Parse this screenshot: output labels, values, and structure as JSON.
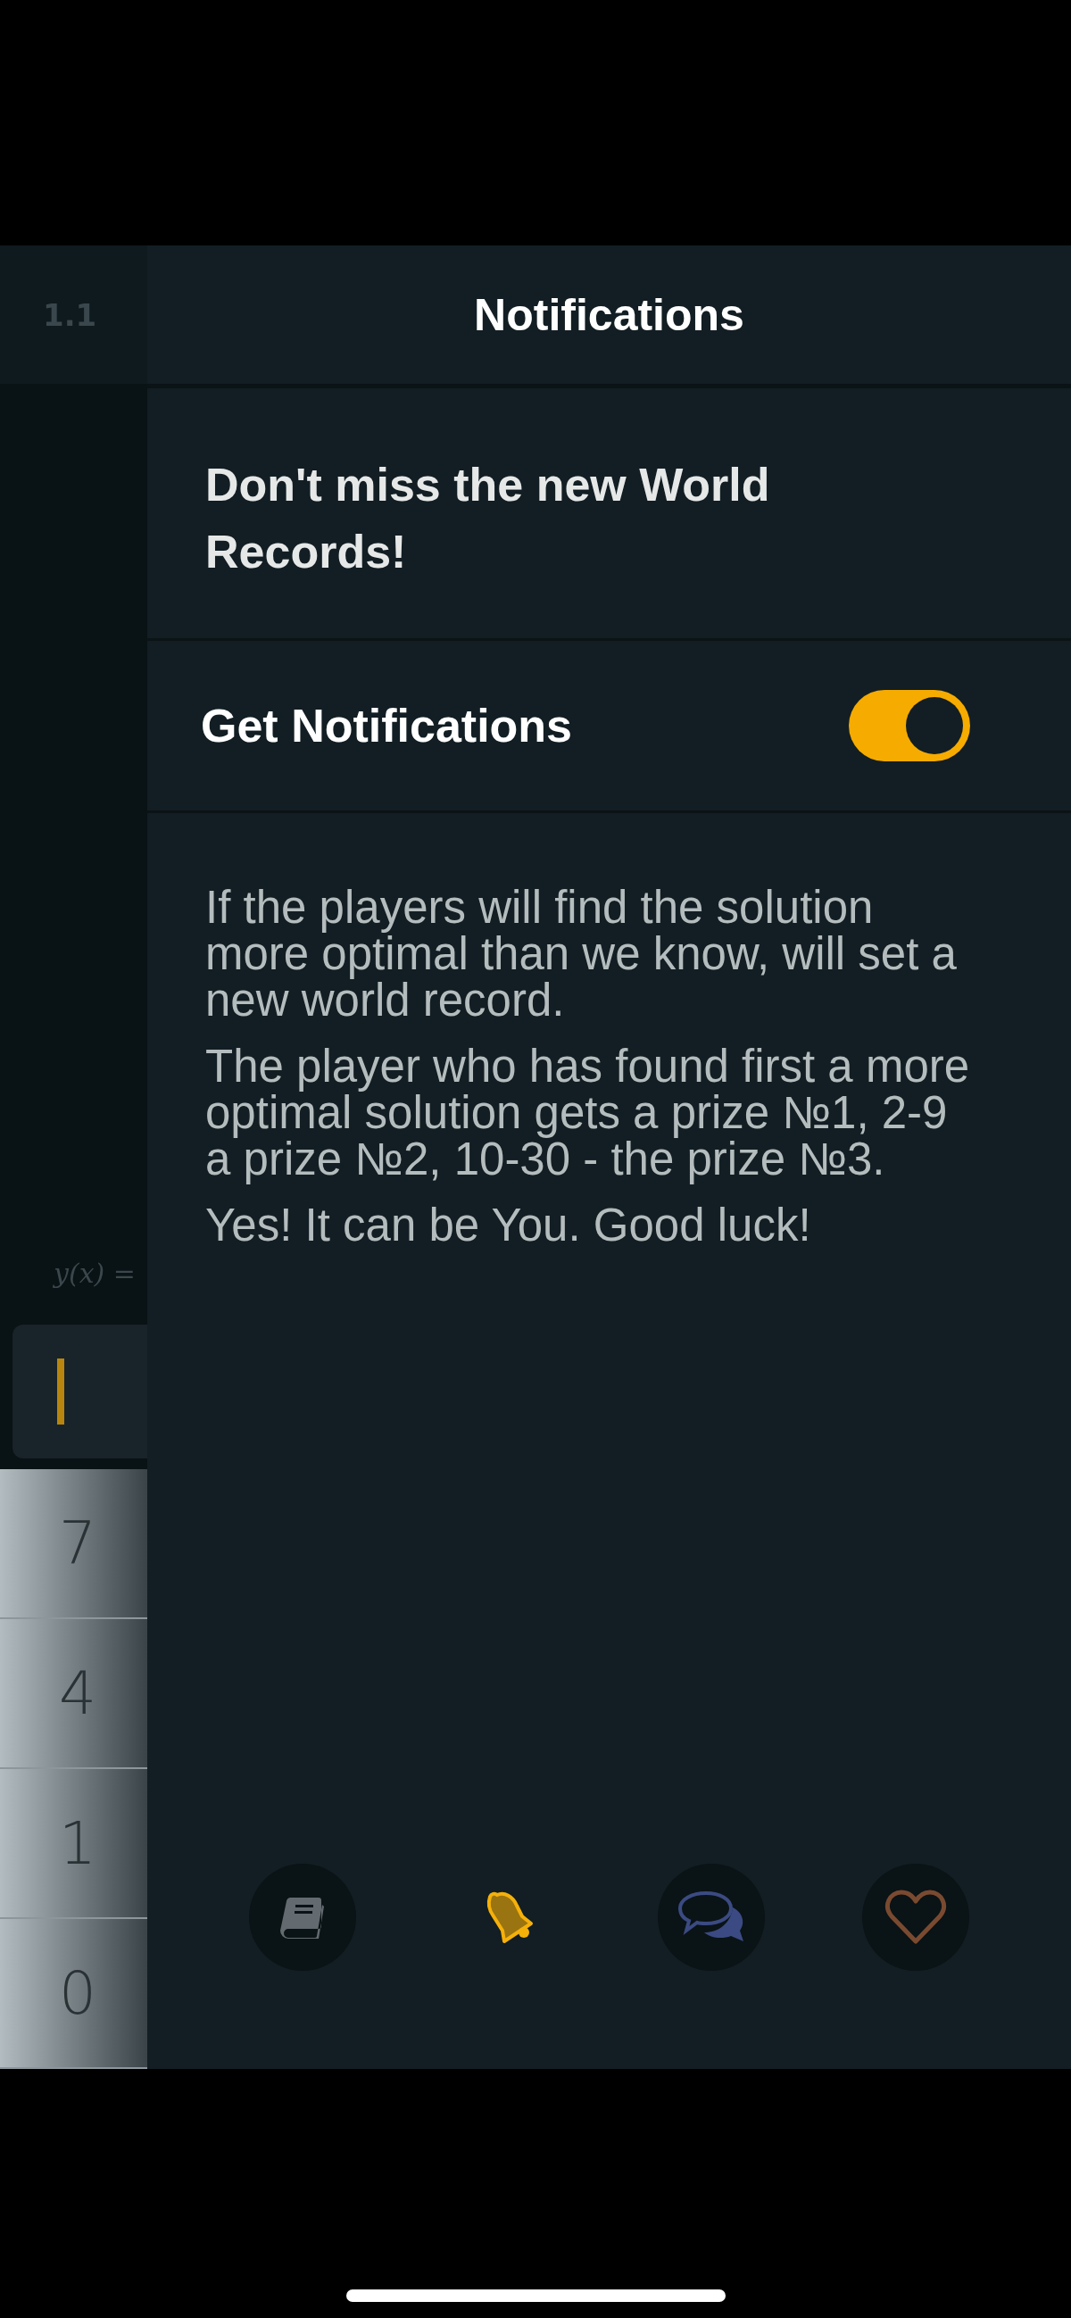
{
  "background_app": {
    "tab_label": "1.1",
    "formula_label": "y(x) =",
    "keypad_keys": [
      "7",
      "4",
      "1",
      "0"
    ]
  },
  "header": {
    "title": "Notifications"
  },
  "promo": {
    "heading": "Don't miss the new World Records!"
  },
  "setting": {
    "label": "Get Notifications",
    "on": true
  },
  "paragraphs": [
    "If the players will find the solution more optimal than we know, will set a new world record.",
    "The player who has found first a more optimal solution gets a prize №1, 2-9 a prize №2, 10-30 - the prize №3.",
    "Yes! It can be You. Good luck!"
  ],
  "tab_bar": [
    {
      "kind": "book",
      "selected": false,
      "color": "#646b70"
    },
    {
      "kind": "bell",
      "selected": true,
      "color": "#f5b00a"
    },
    {
      "kind": "chat",
      "selected": false,
      "color": "#3b4a82"
    },
    {
      "kind": "heart",
      "selected": false,
      "color": "#7a4a30"
    }
  ]
}
